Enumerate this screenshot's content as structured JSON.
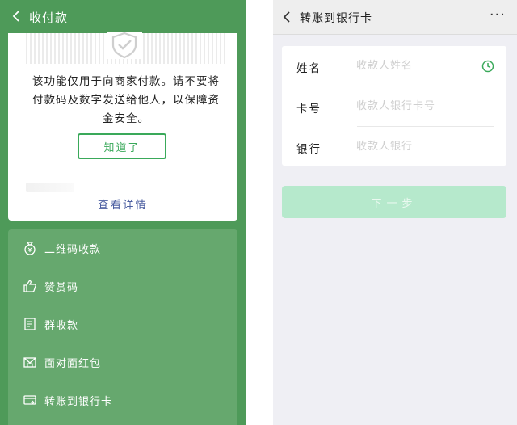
{
  "left_screen": {
    "header": {
      "title": "收付款"
    },
    "notice": {
      "text": "该功能仅用于向商家付款。请不要将付款码及数字发送给他人，以保障资金安全。",
      "confirm_label": "知道了",
      "detail_link": "查看详情"
    },
    "menu": {
      "items": [
        {
          "label": "二维码收款",
          "icon": "money-bag-icon"
        },
        {
          "label": "赞赏码",
          "icon": "thumbs-up-icon"
        },
        {
          "label": "群收款",
          "icon": "group-bill-icon"
        },
        {
          "label": "面对面红包",
          "icon": "red-packet-icon"
        },
        {
          "label": "转账到银行卡",
          "icon": "bank-card-icon"
        }
      ]
    }
  },
  "right_screen": {
    "header": {
      "title": "转账到银行卡",
      "more": "···"
    },
    "form": {
      "name_label": "姓名",
      "name_placeholder": "收款人姓名",
      "card_label": "卡号",
      "card_placeholder": "收款人银行卡号",
      "bank_label": "银行",
      "bank_placeholder": "收款人银行"
    },
    "next_label": "下一步"
  },
  "colors": {
    "left_background": "#4e9a59",
    "menu_background": "#66a86e",
    "accent_green": "#3aa95a",
    "link_blue": "#4a5da0",
    "next_button_disabled": "#b6e9cc",
    "right_background": "#efeff4"
  }
}
